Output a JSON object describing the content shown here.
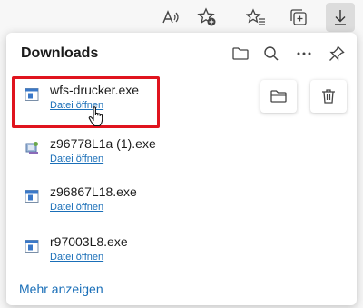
{
  "toolbar": {
    "icons": [
      "read-aloud-icon",
      "add-favorite-icon",
      "favorites-icon",
      "collections-icon",
      "downloads-icon"
    ]
  },
  "panel": {
    "title": "Downloads",
    "header_icons": [
      "open-folder-icon",
      "search-icon",
      "more-options-icon",
      "pin-icon"
    ]
  },
  "downloads": [
    {
      "name": "wfs-drucker.exe",
      "action": "Datei öffnen"
    },
    {
      "name": "z96778L1a (1).exe",
      "action": "Datei öffnen"
    },
    {
      "name": "z96867L18.exe",
      "action": "Datei öffnen"
    },
    {
      "name": "r97003L8.exe",
      "action": "Datei öffnen"
    }
  ],
  "footer": {
    "show_more": "Mehr anzeigen"
  },
  "colors": {
    "link": "#1a6fb8",
    "highlight": "#e0141e"
  }
}
